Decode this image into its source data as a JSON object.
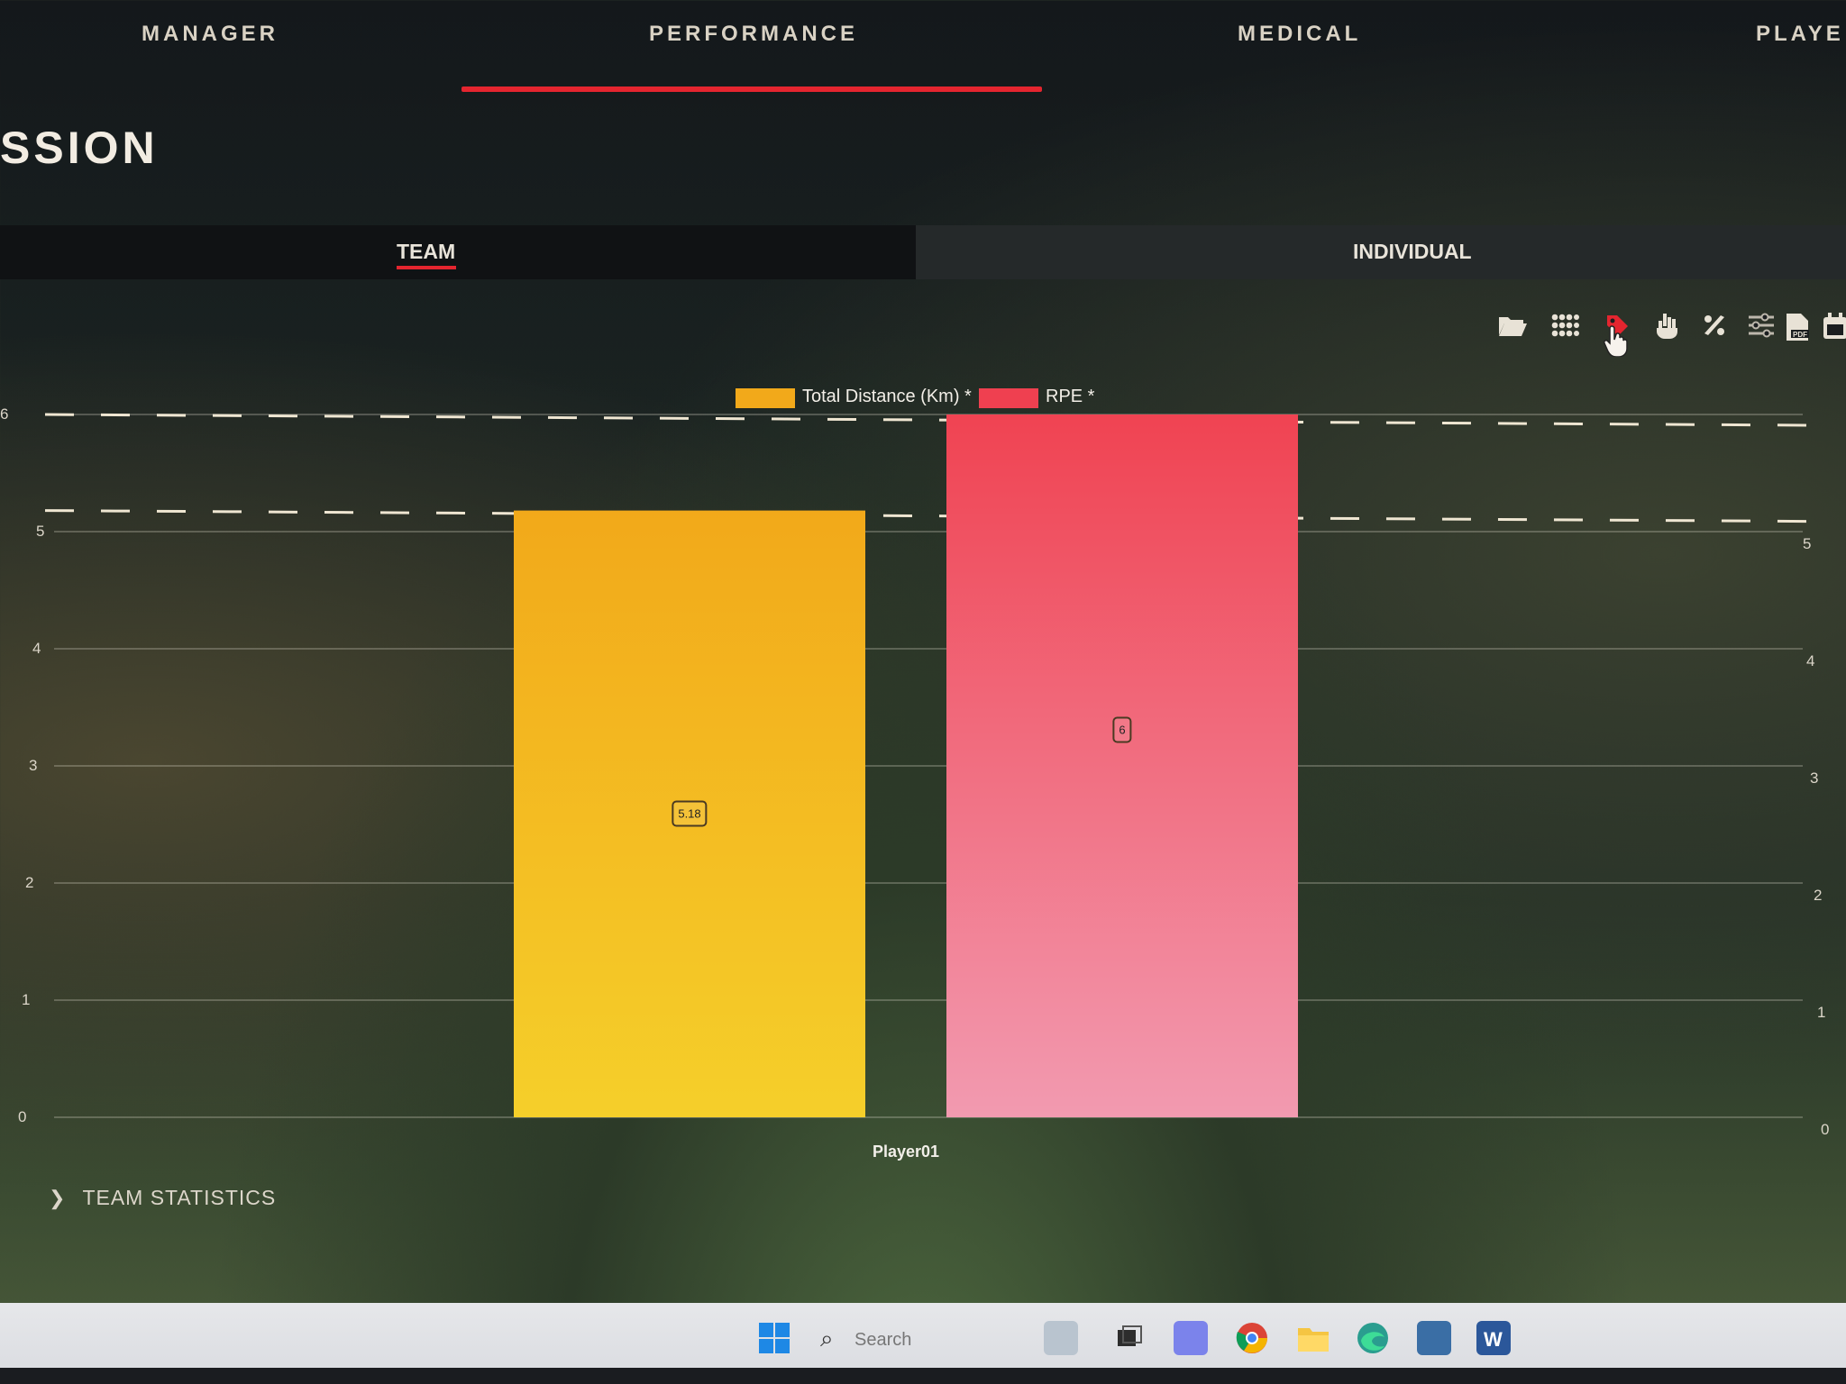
{
  "nav": {
    "items": [
      "MANAGER",
      "PERFORMANCE",
      "MEDICAL",
      "PLAYE"
    ],
    "active": "PERFORMANCE"
  },
  "page": {
    "title": "SSION"
  },
  "tabs": {
    "team": "TEAM",
    "individual": "INDIVIDUAL",
    "active": "TEAM"
  },
  "toolbar": {
    "icons": [
      "folder-open-icon",
      "grid-icon",
      "tag-icon",
      "hand-pointer-icon",
      "percent-icon",
      "filter-sliders-icon",
      "pdf-icon",
      "calendar-icon"
    ]
  },
  "colors": {
    "accent": "#e4252f",
    "series_distance": "#f2a91a",
    "series_rpe": "#ef4050"
  },
  "chart_data": {
    "type": "bar",
    "categories": [
      "Player01"
    ],
    "series": [
      {
        "name": "Total Distance (Km) *",
        "values": [
          5.18
        ],
        "color": "#f2a91a",
        "label": "5.18",
        "reference_line": 5.18
      },
      {
        "name": "RPE *",
        "values": [
          6
        ],
        "color": "#ef4050",
        "label": "6",
        "reference_line": 6
      }
    ],
    "y_left": {
      "ticks": [
        "0",
        "1",
        "2",
        "3",
        "4",
        "5",
        "6"
      ],
      "range": [
        0,
        6
      ]
    },
    "y_right": {
      "ticks": [
        "0",
        "1",
        "2",
        "3",
        "4",
        "5"
      ],
      "range": [
        0,
        6
      ]
    },
    "legend_placement": "top-center",
    "grid": true
  },
  "team_statistics": {
    "label": "TEAM STATISTICS"
  },
  "taskbar": {
    "search_placeholder": "Search",
    "apps": [
      "windows-start-icon",
      "search-icon",
      "widgets-icon",
      "file-explorer-icon",
      "teams-icon",
      "chrome-icon",
      "folder-icon",
      "edge-icon",
      "store-icon",
      "word-icon"
    ]
  }
}
